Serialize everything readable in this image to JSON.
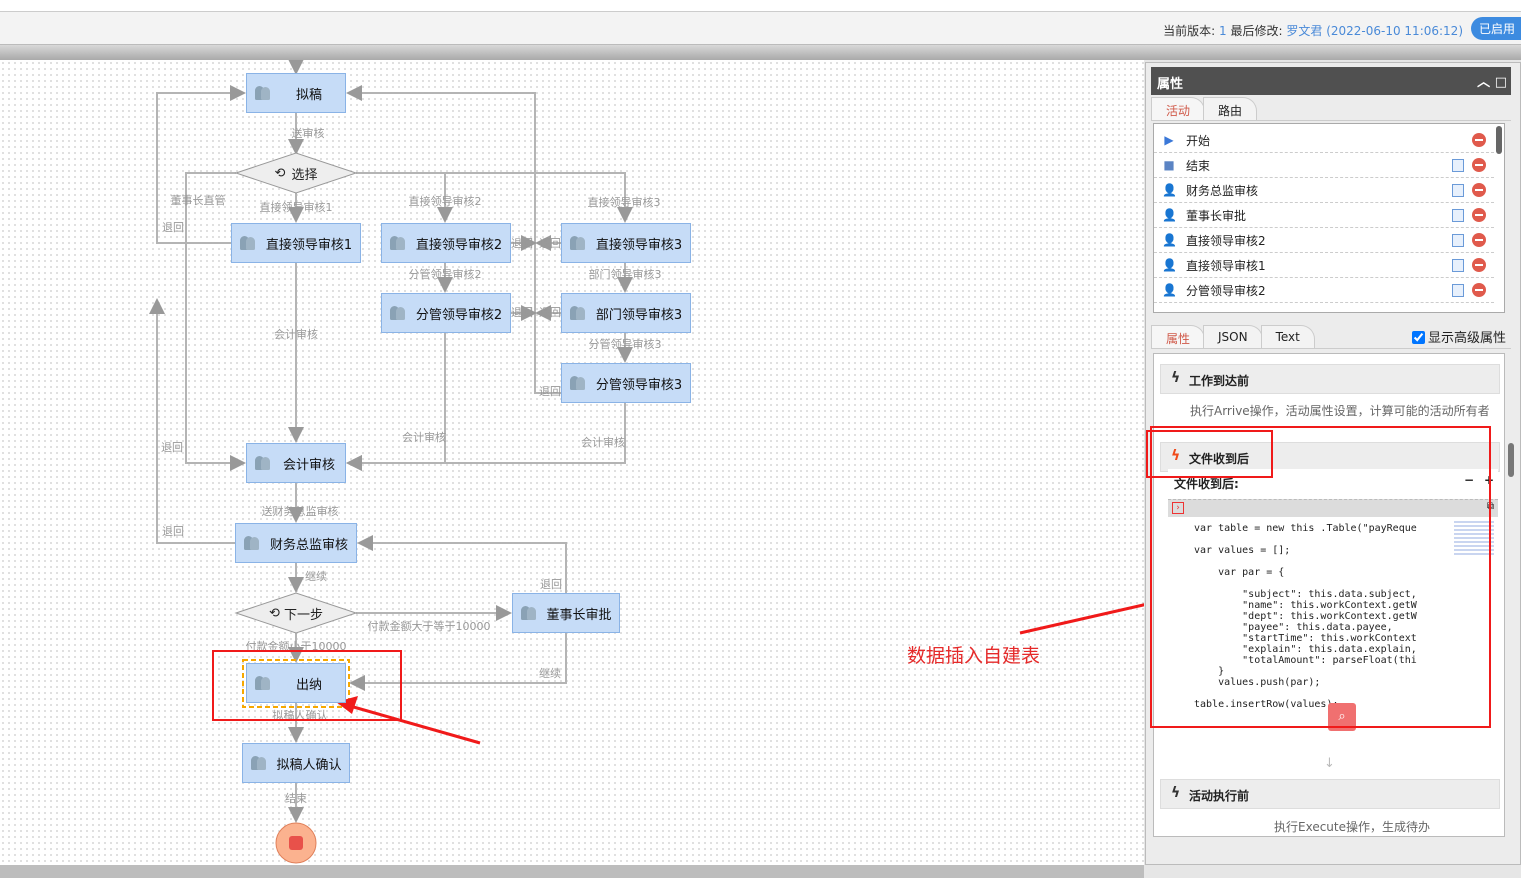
{
  "header": {
    "version_label": "当前版本:",
    "version": "1",
    "modified_label": "最后修改:",
    "modifier": "罗文君",
    "modified_time": "(2022-06-10 11:06:12)",
    "status": "已启用"
  },
  "flow": {
    "nodes": {
      "draft": "拟稿",
      "choose": "选择",
      "direct1": "直接领导审核1",
      "direct2": "直接领导审核2",
      "direct3": "直接领导审核3",
      "branch2": "分管领导审核2",
      "dept3": "部门领导审核3",
      "branch3": "分管领导审核3",
      "accounting": "会计审核",
      "cfo": "财务总监审核",
      "next": "下一步",
      "chairman": "董事长审批",
      "cashier": "出纳",
      "confirm": "拟稿人确认"
    },
    "edge_labels": [
      "送审核",
      "董事长直管",
      "直接领导审核1",
      "直接领导审核2",
      "直接领导审核3",
      "退回",
      "退回",
      "退回",
      "分管领导审核2",
      "部门领导审核3",
      "退回",
      "退回",
      "会计审核",
      "分管领导审核3",
      "退回",
      "会计审核",
      "会计审核",
      "退回",
      "送财务总监审核",
      "退回",
      "继续",
      "退回",
      "付款金额大于等于10000",
      "付款金额小于10000",
      "继续",
      "拟稿人确认",
      "结束"
    ]
  },
  "annotation": "数据插入自建表",
  "panel": {
    "title": "属性",
    "top_tabs": [
      "活动",
      "路由"
    ],
    "activities": [
      {
        "name": "开始",
        "icon": "play-icon"
      },
      {
        "name": "结束",
        "icon": "stop-icon"
      },
      {
        "name": "财务总监审核",
        "icon": "user-icon"
      },
      {
        "name": "董事长审批",
        "icon": "user-icon"
      },
      {
        "name": "直接领导审核2",
        "icon": "user-icon"
      },
      {
        "name": "直接领导审核1",
        "icon": "user-icon"
      },
      {
        "name": "分管领导审核2",
        "icon": "user-icon"
      }
    ],
    "bottom_tabs": [
      "属性",
      "JSON",
      "Text"
    ],
    "show_advanced": "显示高级属性",
    "show_advanced_checked": true,
    "sections": {
      "arrive": {
        "title": "工作到达前",
        "desc": "执行Arrive操作，活动属性设置，计算可能的活动所有者"
      },
      "received": {
        "title": "文件收到后",
        "editor_label": "文件收到后:",
        "minus": "−",
        "plus": "+"
      },
      "execute": {
        "title": "活动执行前",
        "desc": "执行Execute操作，生成待办"
      }
    },
    "code": "var table = new this .Table(\"payReque\n\nvar values = [];\n\n    var par = {\n\n        \"subject\": this.data.subject,\n        \"name\": this.workContext.getW\n        \"dept\": this.workContext.getW\n        \"payee\": this.data.payee,\n        \"startTime\": this.workContext\n        \"explain\": this.data.explain,\n        \"totalAmount\": parseFloat(thi\n    }\n    values.push(par);\n\ntable.insertRow(values);"
  }
}
